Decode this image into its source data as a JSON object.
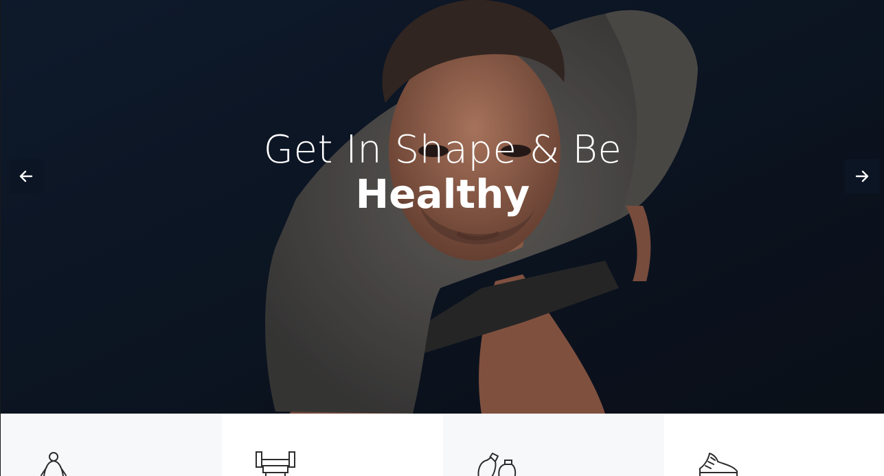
{
  "hero": {
    "title_line1": "Get In Shape & Be",
    "title_line2": "Healthy",
    "background_color": "#0e1a2b",
    "prev_icon": "arrow-left-icon",
    "next_icon": "arrow-right-icon"
  },
  "features": [
    {
      "icon": "meditation-icon"
    },
    {
      "icon": "dumbbell-bench-icon"
    },
    {
      "icon": "boxing-gloves-icon"
    },
    {
      "icon": "running-shoe-icon"
    }
  ]
}
